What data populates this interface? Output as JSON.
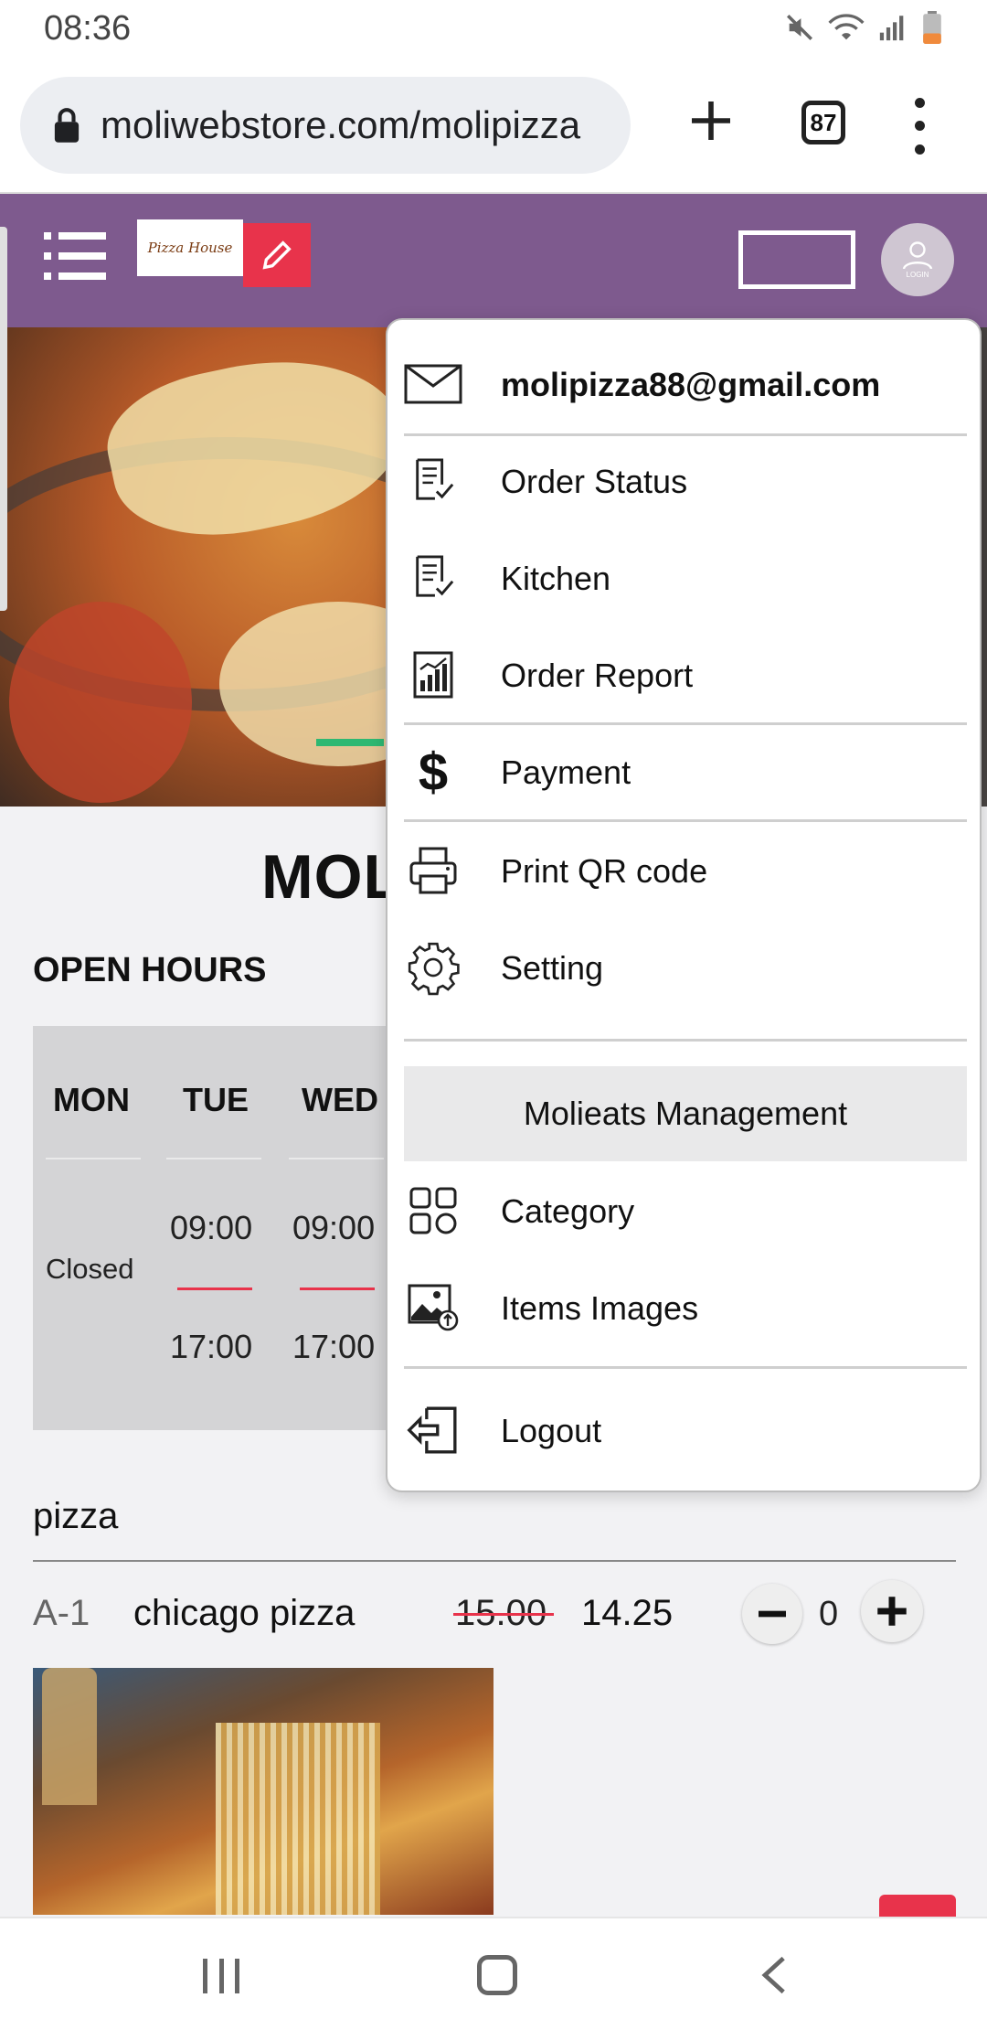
{
  "status_bar": {
    "time": "08:36",
    "icons": [
      "mute-icon",
      "wifi-icon",
      "signal-icon",
      "battery-icon"
    ]
  },
  "browser": {
    "url": "moliwebstore.com/molipizza",
    "tab_count": "87"
  },
  "header": {
    "logo_text": "Pizza House",
    "login_label": "LOGIN",
    "colors": {
      "header_bg": "#7e5a8e",
      "accent_red": "#e8334b",
      "accent_green": "#2eb872"
    }
  },
  "store": {
    "title": "MOL",
    "open_hours_title": "OPEN HOURS",
    "days": [
      {
        "day": "MON",
        "closed": "Closed"
      },
      {
        "day": "TUE",
        "open": "09:00",
        "close": "17:00"
      },
      {
        "day": "WED",
        "open": "09:00",
        "close": "17:00"
      }
    ]
  },
  "category": {
    "name": "pizza",
    "items": [
      {
        "code": "A-1",
        "name": "chicago pizza",
        "old_price": "15.00",
        "price": "14.25",
        "qty": "0"
      }
    ]
  },
  "menu": {
    "email": "molipizza88@gmail.com",
    "items": [
      {
        "label": "Order Status",
        "icon": "order-status-icon"
      },
      {
        "label": "Kitchen",
        "icon": "kitchen-icon"
      },
      {
        "label": "Order Report",
        "icon": "report-chart-icon"
      },
      {
        "label": "Payment",
        "icon": "dollar-icon"
      },
      {
        "label": "Print QR code",
        "icon": "printer-icon"
      },
      {
        "label": "Setting",
        "icon": "gear-icon"
      }
    ],
    "section_title": "Molieats Management",
    "management_items": [
      {
        "label": "Category",
        "icon": "category-grid-icon"
      },
      {
        "label": "Items Images",
        "icon": "image-upload-icon"
      }
    ],
    "logout": "Logout"
  }
}
